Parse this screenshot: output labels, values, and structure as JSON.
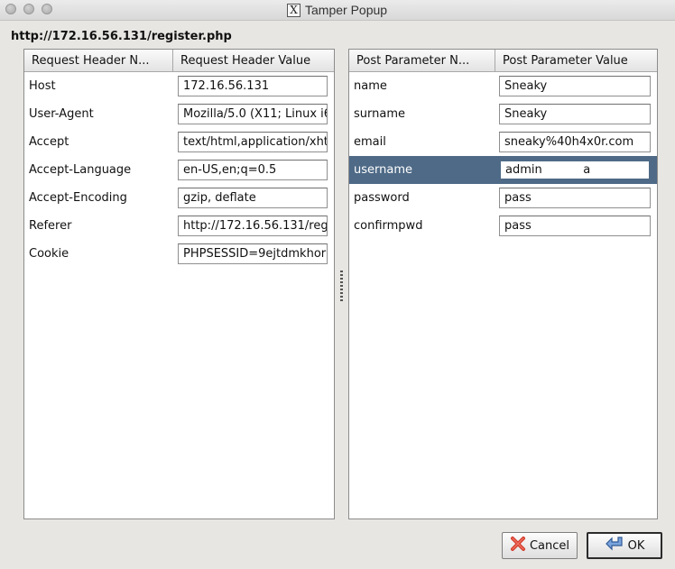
{
  "window": {
    "title": "Tamper Popup"
  },
  "url": "http://172.16.56.131/register.php",
  "headers": {
    "col_name": "Request Header N...",
    "col_value": "Request Header Value",
    "rows": [
      {
        "name": "Host",
        "value": "172.16.56.131"
      },
      {
        "name": "User-Agent",
        "value": "Mozilla/5.0 (X11; Linux i6"
      },
      {
        "name": "Accept",
        "value": "text/html,application/xhtı"
      },
      {
        "name": "Accept-Language",
        "value": "en-US,en;q=0.5"
      },
      {
        "name": "Accept-Encoding",
        "value": "gzip, deflate"
      },
      {
        "name": "Referer",
        "value": "http://172.16.56.131/regi"
      },
      {
        "name": "Cookie",
        "value": "PHPSESSID=9ejtdmkhor"
      }
    ]
  },
  "params": {
    "col_name": "Post Parameter N...",
    "col_value": "Post Parameter Value",
    "selected_row": "username",
    "rows": [
      {
        "name": "name",
        "value": "Sneaky"
      },
      {
        "name": "surname",
        "value": "Sneaky"
      },
      {
        "name": "email",
        "value": "sneaky%40h4x0r.com"
      },
      {
        "name": "username",
        "value": "admin           a"
      },
      {
        "name": "password",
        "value": "pass"
      },
      {
        "name": "confirmpwd",
        "value": "pass"
      }
    ]
  },
  "buttons": {
    "cancel": "Cancel",
    "ok": "OK"
  },
  "icons": {
    "window": "x11-icon",
    "cancel": "red-x-icon",
    "ok": "blue-arrow-icon"
  },
  "colors": {
    "selection": "#4e6a87",
    "cancel_icon": "#d23a2a",
    "ok_icon": "#3d6fb5"
  }
}
